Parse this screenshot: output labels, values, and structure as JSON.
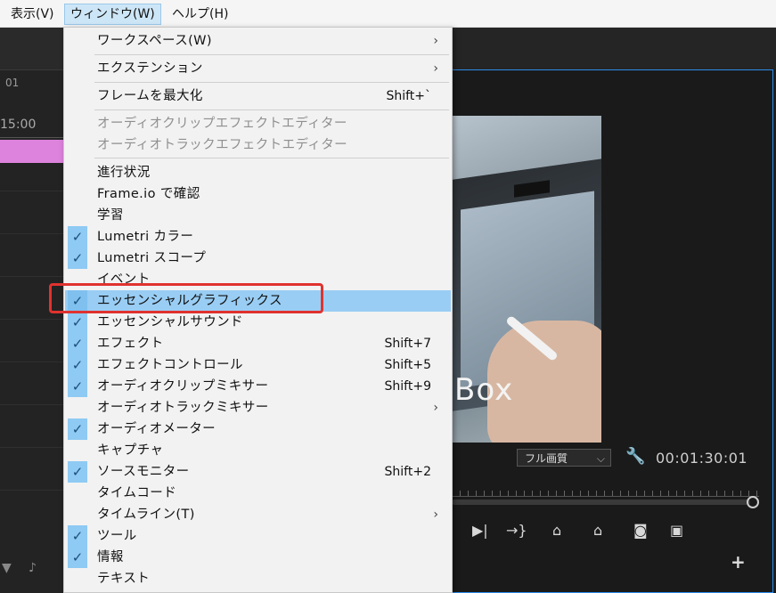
{
  "menubar": {
    "items": [
      {
        "label": "表示(V)"
      },
      {
        "label": "ウィンドウ(W)",
        "active": true
      },
      {
        "label": "ヘルプ(H)"
      }
    ]
  },
  "background": {
    "left": {
      "small_timecode": "01",
      "ruler_time": "15:00"
    },
    "program_monitor": {
      "overlay_text": "Box",
      "quality": "フル画質",
      "timecode": "00:01:30:01",
      "add_button": "+"
    }
  },
  "dropdown": {
    "items": [
      {
        "label": "ワークスペース(W)",
        "submenu": true
      },
      {
        "label": "エクステンション",
        "submenu": true
      },
      {
        "label": "フレームを最大化",
        "shortcut": "Shift+`"
      },
      {
        "label": "オーディオクリップエフェクトエディター",
        "disabled": true
      },
      {
        "label": "オーディオトラックエフェクトエディター",
        "disabled": true
      },
      {
        "label": "進行状況"
      },
      {
        "label": "Frame.io で確認"
      },
      {
        "label": "学習"
      },
      {
        "label": "Lumetri カラー",
        "checked": true
      },
      {
        "label": "Lumetri スコープ",
        "checked": true
      },
      {
        "label": "イベント"
      },
      {
        "label": "エッセンシャルグラフィックス",
        "checked": true,
        "highlighted": true
      },
      {
        "label": "エッセンシャルサウンド",
        "checked": true
      },
      {
        "label": "エフェクト",
        "checked": true,
        "shortcut": "Shift+7"
      },
      {
        "label": "エフェクトコントロール",
        "checked": true,
        "shortcut": "Shift+5"
      },
      {
        "label": "オーディオクリップミキサー",
        "checked": true,
        "shortcut": "Shift+9"
      },
      {
        "label": "オーディオトラックミキサー",
        "submenu": true
      },
      {
        "label": "オーディオメーター",
        "checked": true
      },
      {
        "label": "キャプチャ"
      },
      {
        "label": "ソースモニター",
        "checked": true,
        "shortcut": "Shift+2"
      },
      {
        "label": "タイムコード"
      },
      {
        "label": "タイムライン(T)",
        "submenu": true
      },
      {
        "label": "ツール",
        "checked": true
      },
      {
        "label": "情報",
        "checked": true
      },
      {
        "label": "テキスト"
      }
    ]
  },
  "colors": {
    "highlight": "#99cdf4",
    "check_bg": "#8ecaf3",
    "callout": "#e0322f",
    "monitor_border": "#2d8ceb"
  }
}
